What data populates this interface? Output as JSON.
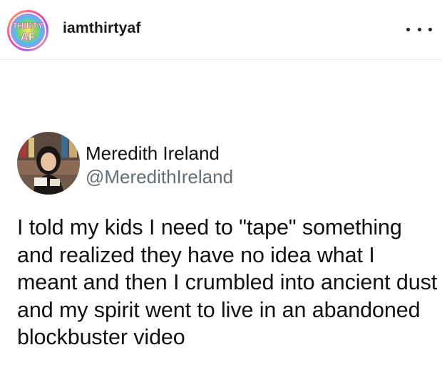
{
  "instagram_post": {
    "account": {
      "username": "iamthirtyaf",
      "avatar_logo_text_line1": "THIRTY",
      "avatar_logo_text_line2": "AF",
      "more_icon": "more-horizontal-icon"
    }
  },
  "tweet": {
    "author_name": "Meredith Ireland",
    "author_handle": "@MeredithIreland",
    "text": "I told my kids I need to \"tape\" something and realized they have no idea what I meant and then I crumbled into ancient dust and my spirit went to live in an abandoned blockbuster video"
  },
  "colors": {
    "handle_gray": "#626e78",
    "text": "#111111",
    "logo_ring_start": "#ff4fa3",
    "logo_ring_end": "#ffd84a",
    "logo_text": "#ffffff"
  }
}
